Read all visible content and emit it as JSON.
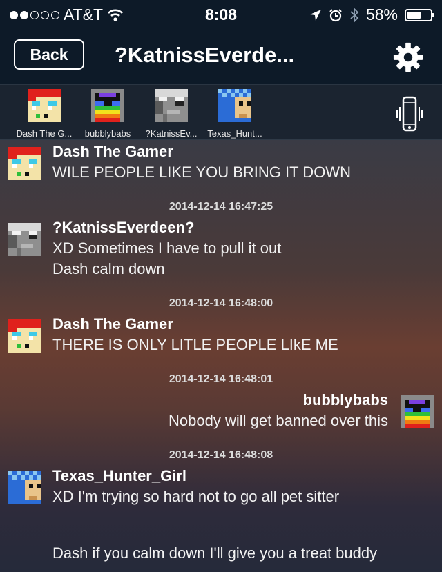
{
  "status_bar": {
    "carrier": "AT&T",
    "time": "8:08",
    "battery": "58%",
    "signal_icon": "signal-dots-icon",
    "wifi_icon": "wifi-icon",
    "location_icon": "location-arrow-icon",
    "alarm_icon": "alarm-icon",
    "bluetooth_icon": "bluetooth-icon",
    "battery_level": 0.58
  },
  "nav": {
    "back_label": "Back",
    "title": "?KatnissEverde...",
    "settings_icon": "gear-icon"
  },
  "users": [
    {
      "label": "Dash The G...",
      "avatar": "dash-avatar"
    },
    {
      "label": "bubblybabs",
      "avatar": "bubbly-avatar"
    },
    {
      "label": "?KatnissEv...",
      "avatar": "katniss-avatar"
    },
    {
      "label": "Texas_Hunt...",
      "avatar": "texas-avatar"
    }
  ],
  "vibrate_icon": "phone-vibrate-icon",
  "messages": [
    {
      "sender": "Dash The Gamer",
      "lines": [
        "WILE PEOPLE LIKE YOU BRING IT DOWN"
      ]
    },
    {
      "timestamp": "2014-12-14 16:47:25",
      "sender": "?KatnissEverdeen?",
      "lines": [
        "XD Sometimes I have to pull it out",
        "Dash calm down"
      ]
    },
    {
      "timestamp": "2014-12-14 16:48:00",
      "sender": "Dash The Gamer",
      "lines": [
        "THERE IS ONLY LITLE PEOPLE LIkE ME"
      ]
    },
    {
      "timestamp": "2014-12-14 16:48:01",
      "sender": "bubblybabs",
      "lines": [
        "Nobody will get banned over this"
      ]
    },
    {
      "timestamp": "2014-12-14 16:48:08",
      "sender": "Texas_Hunter_Girl",
      "lines": [
        "XD I'm trying so hard not to go all pet sitter",
        "Dash if you calm down I'll give you a treat buddy"
      ]
    }
  ]
}
